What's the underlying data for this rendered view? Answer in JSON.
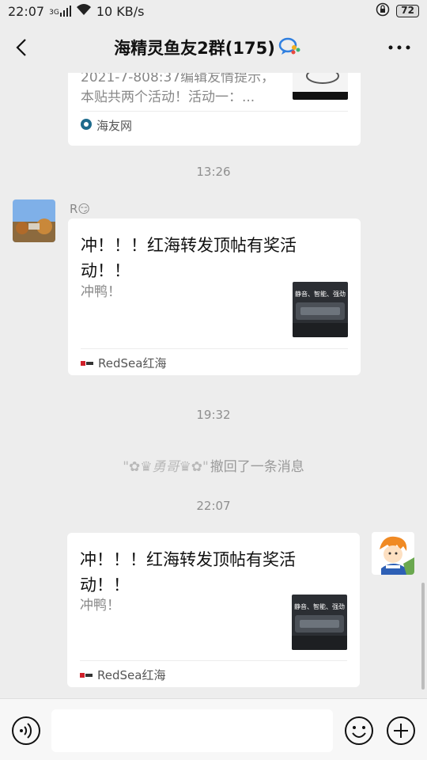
{
  "status_bar": {
    "time": "22:07",
    "network": "3G",
    "speed": "10 KB/s",
    "battery": "72"
  },
  "header": {
    "title": "海精灵鱼友2群(175)"
  },
  "messages": {
    "top_card": {
      "desc_line1": "2021-7-808:37编辑友情提示，",
      "desc_line2": "本贴共两个活动！活动一：...",
      "source": "海友网"
    },
    "time1": "13:26",
    "sender1": {
      "name": "R😏"
    },
    "card1": {
      "title_line1": "冲！！！红海转发顶帖有奖活",
      "title_line2": "动！！",
      "desc": "冲鸭！",
      "thumb_text": "静音、智能、强劲",
      "source": "RedSea红海"
    },
    "time2": "19:32",
    "recall": {
      "name": "\"✿♛勇哥♛✿\"",
      "text": "撤回了一条消息"
    },
    "time3": "22:07",
    "card2": {
      "title_line1": "冲！！！红海转发顶帖有奖活",
      "title_line2": "动！！",
      "desc": "冲鸭！",
      "thumb_text": "静音、智能、强劲",
      "source": "RedSea红海"
    }
  },
  "input_bar": {
    "placeholder": ""
  },
  "colors": {
    "background": "#ededed",
    "card": "#ffffff",
    "accent_blue": "#1e6fd9"
  }
}
